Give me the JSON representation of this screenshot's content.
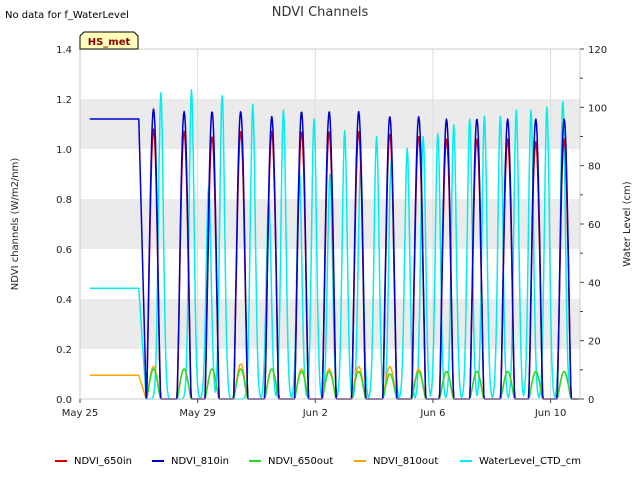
{
  "no_data_text": "No data for f_WaterLevel",
  "badge_label": "HS_met",
  "colors": {
    "NDVI_650in": "#dd0000",
    "NDVI_810in": "#0000cc",
    "NDVI_650out": "#22dd22",
    "NDVI_810out": "#ffa500",
    "WaterLevel_CTD_cm": "#00eeee",
    "band": "#ebebeb",
    "badge_fill": "#ffffbb"
  },
  "chart_data": {
    "type": "line",
    "title": "NDVI Channels",
    "ylabel": "NDVI channels (W/m2/nm)",
    "y2label": "Water Level (cm)",
    "xlabel": "",
    "xlim": [
      "2024-05-25",
      "2024-06-11"
    ],
    "ylim": [
      0,
      1.4
    ],
    "y2lim": [
      0,
      120
    ],
    "x_ticks": [
      {
        "date": "2024-05-25",
        "label": "May 25"
      },
      {
        "date": "2024-05-29",
        "label": "May 29"
      },
      {
        "date": "2024-06-02",
        "label": "Jun 2"
      },
      {
        "date": "2024-06-06",
        "label": "Jun 6"
      },
      {
        "date": "2024-06-10",
        "label": "Jun 10"
      }
    ],
    "y_ticks": [
      "0.0",
      "0.2",
      "0.4",
      "0.6",
      "0.8",
      "1.0",
      "1.2",
      "1.4"
    ],
    "y2_ticks": [
      "0",
      "20",
      "40",
      "60",
      "80",
      "100",
      "120"
    ],
    "grid": true,
    "legend_position": "bottom",
    "flat_segment": {
      "start": "2024-05-25T08:00",
      "end": "2024-05-27T00:00",
      "NDVI_810in": 1.12,
      "NDVI_810out": 0.095,
      "WaterLevel_CTD_cm": 38
    },
    "daily_peaks": {
      "days": [
        "2024-05-27",
        "2024-05-28",
        "2024-05-29",
        "2024-05-30",
        "2024-05-31",
        "2024-06-01",
        "2024-06-02",
        "2024-06-03",
        "2024-06-04",
        "2024-06-05",
        "2024-06-06",
        "2024-06-07",
        "2024-06-08",
        "2024-06-09",
        "2024-06-10"
      ],
      "NDVI_810in": [
        1.16,
        1.15,
        1.15,
        1.15,
        1.13,
        1.15,
        1.15,
        1.15,
        1.13,
        1.13,
        1.12,
        1.12,
        1.12,
        1.12,
        1.12
      ],
      "NDVI_650in": [
        1.08,
        1.07,
        1.05,
        1.07,
        1.07,
        1.07,
        1.07,
        1.07,
        1.06,
        1.05,
        1.04,
        1.04,
        1.04,
        1.03,
        1.04
      ],
      "NDVI_650out": [
        0.12,
        0.12,
        0.12,
        0.12,
        0.12,
        0.11,
        0.11,
        0.11,
        0.1,
        0.11,
        0.11,
        0.11,
        0.11,
        0.11,
        0.11
      ],
      "NDVI_810out": [
        0.13,
        0.12,
        0.12,
        0.14,
        0.12,
        0.12,
        0.12,
        0.13,
        0.13,
        0.12,
        0.11,
        0.11,
        0.11,
        0.11,
        0.11
      ]
    },
    "water_level_peaks": {
      "times": [
        "2024-05-27T18:00",
        "2024-05-28T19:00",
        "2024-05-29T09:00",
        "2024-05-29T20:00",
        "2024-05-30T21:00",
        "2024-05-31T10:00",
        "2024-05-31T22:00",
        "2024-06-01T11:00",
        "2024-06-01T23:00",
        "2024-06-02T12:00",
        "2024-06-03T00:00",
        "2024-06-03T13:00",
        "2024-06-04T02:00",
        "2024-06-04T14:00",
        "2024-06-05T03:00",
        "2024-06-05T16:00",
        "2024-06-06T04:00",
        "2024-06-06T17:00",
        "2024-06-07T06:00",
        "2024-06-07T18:00",
        "2024-06-08T07:00",
        "2024-06-08T20:00",
        "2024-06-09T08:00",
        "2024-06-09T21:00",
        "2024-06-10T10:00"
      ],
      "values_cm": [
        101,
        102,
        69,
        100,
        97,
        64,
        95,
        74,
        92,
        73,
        88,
        76,
        86,
        78,
        82,
        86,
        87,
        90,
        92,
        93,
        93,
        95,
        95,
        96,
        98
      ]
    },
    "series": [
      {
        "name": "NDVI_650in"
      },
      {
        "name": "NDVI_810in"
      },
      {
        "name": "NDVI_650out"
      },
      {
        "name": "NDVI_810out"
      },
      {
        "name": "WaterLevel_CTD_cm"
      }
    ]
  }
}
